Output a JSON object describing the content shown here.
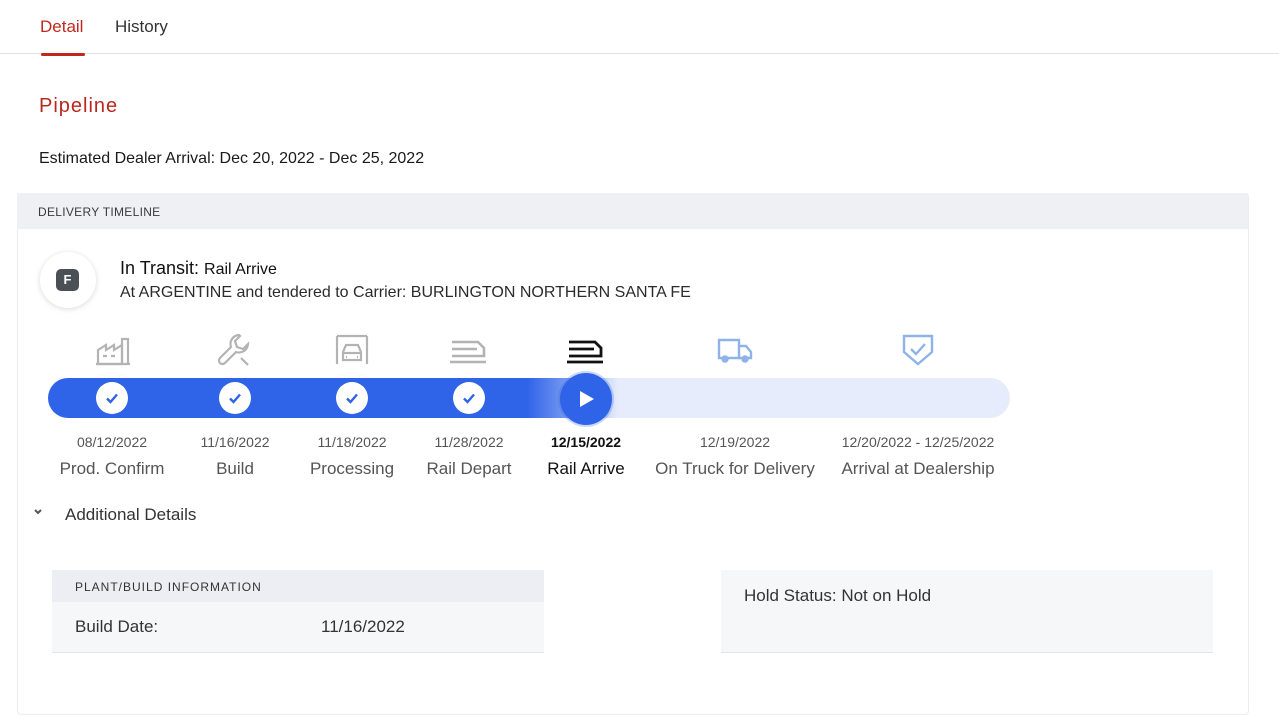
{
  "tabs": [
    {
      "label": "Detail",
      "active": true
    },
    {
      "label": "History",
      "active": false
    }
  ],
  "pipeline": {
    "title": "Pipeline",
    "estimated_label": "Estimated Dealer Arrival:",
    "estimated_value": "Dec 20, 2022 - Dec 25, 2022"
  },
  "timeline": {
    "header": "DELIVERY TIMELINE",
    "status_badge": "F",
    "status_prefix": "In Transit:",
    "status_stage": "Rail Arrive",
    "status_detail": "At ARGENTINE and tendered to Carrier: BURLINGTON NORTHERN SANTA FE",
    "accent_color": "#2f63e8",
    "stages": [
      {
        "date": "08/12/2022",
        "label": "Prod. Confirm",
        "state": "complete",
        "icon": "factory-icon"
      },
      {
        "date": "11/16/2022",
        "label": "Build",
        "state": "complete",
        "icon": "wrench-icon"
      },
      {
        "date": "11/18/2022",
        "label": "Processing",
        "state": "complete",
        "icon": "car-wash-icon"
      },
      {
        "date": "11/28/2022",
        "label": "Rail Depart",
        "state": "complete",
        "icon": "train-icon"
      },
      {
        "date": "12/15/2022",
        "label": "Rail Arrive",
        "state": "current",
        "icon": "train-icon"
      },
      {
        "date": "12/19/2022",
        "label": "On Truck for Delivery",
        "state": "pending",
        "icon": "truck-icon"
      },
      {
        "date": "12/20/2022 - 12/25/2022",
        "label": "Arrival at Dealership",
        "state": "pending",
        "icon": "shield-check-icon"
      }
    ]
  },
  "additional": {
    "toggle_label": "Additional Details",
    "plant_header": "PLANT/BUILD INFORMATION",
    "build_date_label": "Build Date:",
    "build_date_value": "11/16/2022",
    "hold_status": "Hold Status: Not on Hold"
  }
}
